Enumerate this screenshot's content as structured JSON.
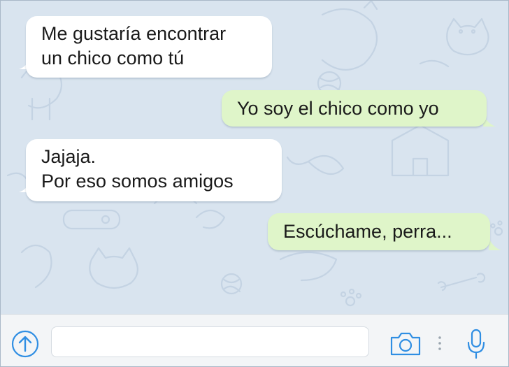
{
  "messages": [
    {
      "direction": "incoming",
      "lines": [
        "Me gustaría encontrar",
        "un chico como tú"
      ]
    },
    {
      "direction": "outgoing",
      "lines": [
        "Yo soy el chico como yo"
      ]
    },
    {
      "direction": "incoming",
      "lines": [
        "Jajaja.",
        "Por eso somos amigos"
      ]
    },
    {
      "direction": "outgoing",
      "lines": [
        "Escúchame, perra..."
      ]
    }
  ],
  "input_bar": {
    "message_value": "",
    "attach_icon": "upload-arrow-icon",
    "camera_icon": "camera-icon",
    "more_icon": "vertical-dots-icon",
    "mic_icon": "microphone-icon"
  },
  "colors": {
    "chat_background": "#d9e4ef",
    "incoming_bubble": "#ffffff",
    "outgoing_bubble": "#dff5c9",
    "accent": "#2f8ee3"
  }
}
